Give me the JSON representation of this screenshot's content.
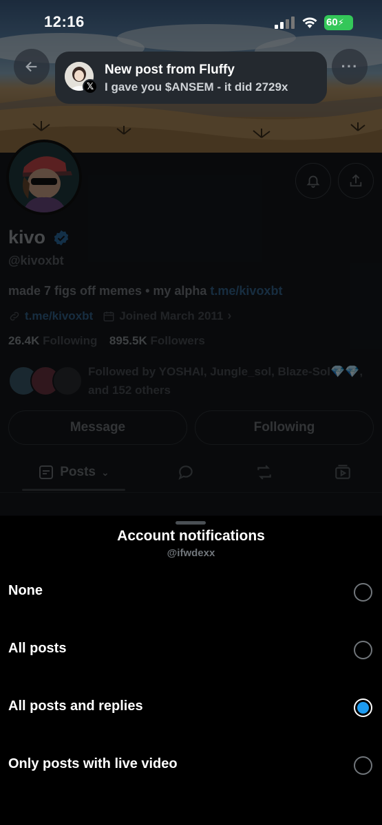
{
  "status_bar": {
    "time": "12:16",
    "battery": "60"
  },
  "notification": {
    "title": "New post from Fluffy",
    "body": "I gave you $ANSEM - it did 2729x"
  },
  "profile": {
    "name": "kivo",
    "handle": "@kivoxbt",
    "bio_text": "made 7 figs off memes • my alpha ",
    "bio_link": "t.me/kivoxbt",
    "website": "t.me/kivoxbt",
    "joined": "Joined March 2011",
    "following_count": "26.4K",
    "following_label": "Following",
    "followers_count": "895.5K",
    "followers_label": "Followers",
    "followed_by": "Followed by YOSHAI, Jungle_sol, Blaze-Sol💎💎, and 152 others",
    "message_button": "Message",
    "following_button": "Following"
  },
  "tabs": [
    {
      "label": "Posts",
      "icon": "posts-icon"
    },
    {
      "label": "",
      "icon": "replies-icon"
    },
    {
      "label": "",
      "icon": "reposts-icon"
    },
    {
      "label": "",
      "icon": "media-icon"
    }
  ],
  "sheet": {
    "title": "Account notifications",
    "subtitle": "@ifwdexx",
    "options": [
      {
        "label": "None",
        "selected": false
      },
      {
        "label": "All posts",
        "selected": false
      },
      {
        "label": "All posts and replies",
        "selected": true
      },
      {
        "label": "Only posts with live video",
        "selected": false
      }
    ]
  },
  "colors": {
    "accent": "#1d9bf0",
    "battery": "#34c759",
    "background": "#000000"
  }
}
